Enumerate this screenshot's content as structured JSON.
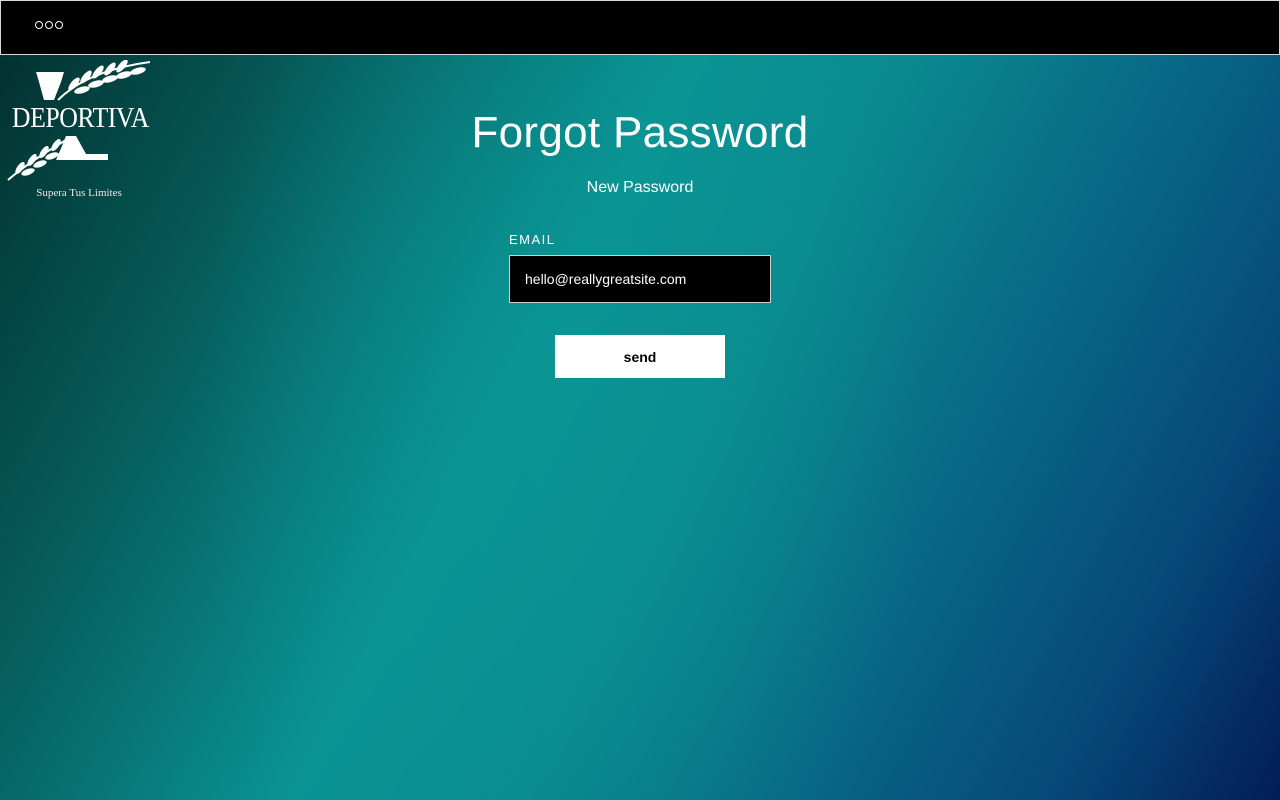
{
  "topbar": {
    "menu_icon": "more-dots-icon"
  },
  "logo": {
    "brand_name": "DEPORTIVA",
    "tagline": "Supera Tus Limites"
  },
  "main": {
    "title": "Forgot Password",
    "subtitle": "New Password",
    "email_label": "EMAIL",
    "email_value": "hello@reallygreatsite.com",
    "send_label": "send"
  },
  "colors": {
    "topbar_bg": "#000000",
    "gradient_dark_teal": "#022e2c",
    "gradient_teal": "#0a9494",
    "gradient_navy": "#031d58",
    "button_bg": "#ffffff",
    "input_bg": "#000000"
  }
}
